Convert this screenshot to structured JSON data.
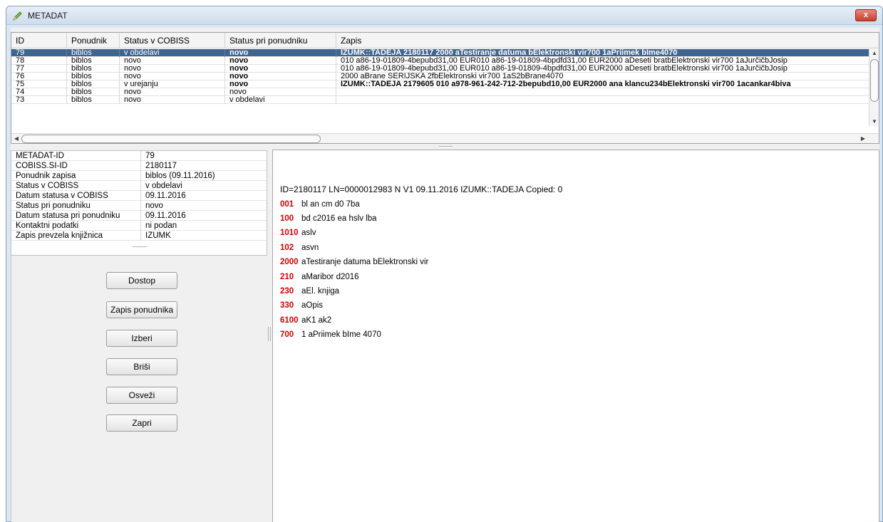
{
  "window": {
    "title": "METADAT",
    "close_label": "x",
    "icon": "pencil-icon"
  },
  "table": {
    "columns": [
      "ID",
      "Ponudnik",
      "Status v COBISS",
      "Status pri ponudniku",
      "Zapis"
    ],
    "rows": [
      {
        "id": "79",
        "ponudnik": "biblos",
        "status_cobiss": "v obdelavi",
        "status_ponudnik": "novo",
        "zapis": "IZUMK::TADEJA 2180117 2000 aTestiranje datuma bElektronski vir700 1aPriimek bIme4070"
      },
      {
        "id": "78",
        "ponudnik": "biblos",
        "status_cobiss": "novo",
        "status_ponudnik": "novo",
        "zapis": "010 a86-19-01809-4bepubd31,00 EUR010 a86-19-01809-4bpdfd31,00 EUR2000 aDeseti bratbElektronski vir700 1aJurčičbJosip"
      },
      {
        "id": "77",
        "ponudnik": "biblos",
        "status_cobiss": "novo",
        "status_ponudnik": "novo",
        "zapis": "010 a86-19-01809-4bepubd31,00 EUR010 a86-19-01809-4bpdfd31,00 EUR2000 aDeseti bratbElektronski vir700 1aJurčičbJosip"
      },
      {
        "id": "76",
        "ponudnik": "biblos",
        "status_cobiss": "novo",
        "status_ponudnik": "novo",
        "zapis": "2000 aBrane SERIJSKA 2fbElektronski vir700 1aS2bBrane4070"
      },
      {
        "id": "75",
        "ponudnik": "biblos",
        "status_cobiss": "v urejanju",
        "status_ponudnik": "novo",
        "zapis": "IZUMK::TADEJA 2179605 010 a978-961-242-712-2bepubd10,00 EUR2000 ana klancu234bElektronski vir700 1acankar4biva"
      },
      {
        "id": "74",
        "ponudnik": "biblos",
        "status_cobiss": "novo",
        "status_ponudnik": "novo",
        "zapis": ""
      },
      {
        "id": "73",
        "ponudnik": "biblos",
        "status_cobiss": "novo",
        "status_ponudnik": "v obdelavi",
        "zapis": ""
      }
    ],
    "selected_row_id": "79"
  },
  "properties": [
    {
      "key": "METADAT-ID",
      "value": "79"
    },
    {
      "key": "COBISS.SI-ID",
      "value": "2180117"
    },
    {
      "key": "Ponudnik zapisa",
      "value": "biblos (09.11.2016)"
    },
    {
      "key": "Status v COBISS",
      "value": "v obdelavi"
    },
    {
      "key": "Datum statusa v COBISS",
      "value": "09.11.2016"
    },
    {
      "key": "Status pri ponudniku",
      "value": "novo"
    },
    {
      "key": "Datum statusa pri ponudniku",
      "value": "09.11.2016"
    },
    {
      "key": "Kontaktni podatki",
      "value": "ni podan"
    },
    {
      "key": "Zapis prevzela knjižnica",
      "value": "IZUMK"
    }
  ],
  "buttons": {
    "dostop": "Dostop",
    "zapis_ponudnika": "Zapis ponudnika",
    "izberi": "Izberi",
    "brisi": "Briši",
    "osvezi": "Osveži",
    "zapri": "Zapri"
  },
  "record": {
    "header": "ID=2180117 LN=0000012983 N V1 09.11.2016 IZUMK::TADEJA Copied: 0",
    "fields": [
      {
        "tag": "001",
        "content": "bl an cm d0 7ba"
      },
      {
        "tag": "100",
        "content": "bd c2016 ea hslv lba"
      },
      {
        "tag": "1010",
        "content": "aslv"
      },
      {
        "tag": "102",
        "content": "asvn"
      },
      {
        "tag": "2000",
        "content": "aTestiranje datuma bElektronski vir"
      },
      {
        "tag": "210",
        "content": "aMaribor d2016"
      },
      {
        "tag": "230",
        "content": "aEl. knjiga"
      },
      {
        "tag": "330",
        "content": "aOpis"
      },
      {
        "tag": "6100",
        "content": "aK1 ak2"
      },
      {
        "tag": "700",
        "content": "1 aPriimek bIme 4070"
      }
    ]
  },
  "colors": {
    "selection": "#3e6590",
    "tag_red": "#d40000",
    "subfield_green": "#1a8f1a"
  }
}
